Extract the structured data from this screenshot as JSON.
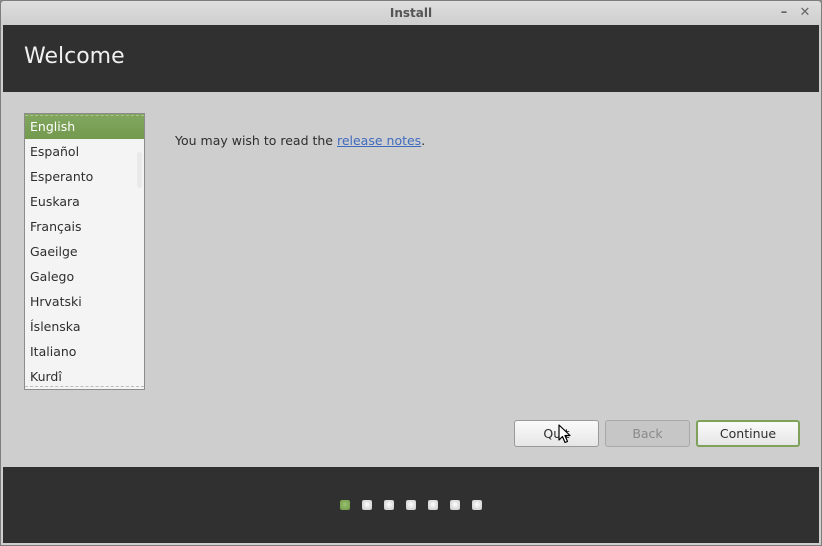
{
  "window": {
    "title": "Install",
    "minimize_label": "–",
    "close_label": "✕"
  },
  "header": {
    "title": "Welcome"
  },
  "languages": {
    "selected": "English",
    "items": [
      {
        "label": "English"
      },
      {
        "label": "Español"
      },
      {
        "label": "Esperanto"
      },
      {
        "label": "Euskara"
      },
      {
        "label": "Français"
      },
      {
        "label": "Gaeilge"
      },
      {
        "label": "Galego"
      },
      {
        "label": "Hrvatski"
      },
      {
        "label": "Íslenska"
      },
      {
        "label": "Italiano"
      },
      {
        "label": "Kurdî"
      }
    ]
  },
  "note": {
    "prefix": "You may wish to read the ",
    "link_text": "release notes",
    "suffix": "."
  },
  "buttons": {
    "quit": "Quit",
    "back": "Back",
    "continue": "Continue"
  },
  "progress": {
    "total_steps": 7,
    "current_step": 1
  },
  "colors": {
    "accent": "#7aa452",
    "header_bg": "#303030",
    "link": "#3f6bbf"
  }
}
